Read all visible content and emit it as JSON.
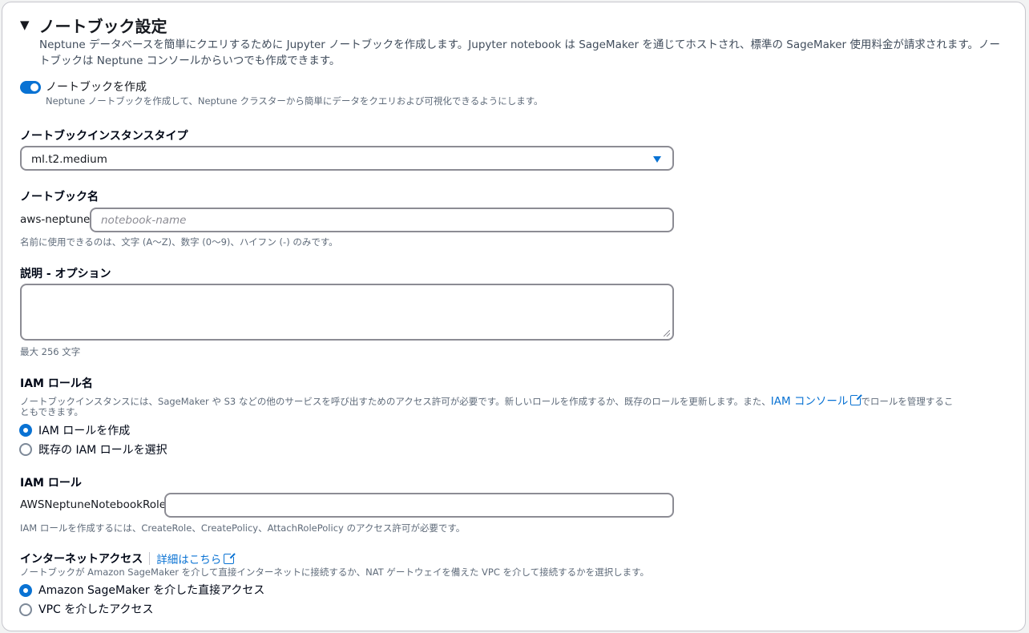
{
  "section": {
    "title": "ノートブック設定",
    "description_line1": "Neptune データベースを簡単にクエリするために Jupyter ノートブックを作成します。Jupyter notebook は SageMaker を通じてホストされ、標準の SageMaker 使用料金が請求されます。ノー",
    "description_line2": "トブックは Neptune コンソールからいつでも作成できます。"
  },
  "create_notebook": {
    "label": "ノートブックを作成",
    "description": "Neptune ノートブックを作成して、Neptune クラスターから簡単にデータをクエリおよび可視化できるようにします。",
    "enabled": true
  },
  "instance_type": {
    "label": "ノートブックインスタンスタイプ",
    "value": "ml.t2.medium"
  },
  "notebook_name": {
    "label": "ノートブック名",
    "prefix": "aws-neptune-",
    "placeholder": "notebook-name",
    "value": "",
    "hint": "名前に使用できるのは、文字 (A〜Z)、数字 (0〜9)、ハイフン (-) のみです。"
  },
  "description_field": {
    "label": "説明 - オプション",
    "value": "",
    "hint": "最大 256 文字"
  },
  "iam_role_name": {
    "label": "IAM ロール名",
    "description_part1": "ノートブックインスタンスには、SageMaker や S3 などの他のサービスを呼び出すためのアクセス許可が必要です。新しいロールを作成するか、既存のロールを更新します。また、",
    "console_link": "IAM コンソール",
    "description_part2": "でロールを管理するこ",
    "description_line2": "ともできます。",
    "options": [
      {
        "label": "IAM ロールを作成",
        "selected": true
      },
      {
        "label": "既存の IAM ロールを選択",
        "selected": false
      }
    ]
  },
  "iam_role": {
    "label": "IAM ロール",
    "prefix": "AWSNeptuneNotebookRole-",
    "value": "",
    "hint": "IAM ロールを作成するには、CreateRole、CreatePolicy、AttachRolePolicy のアクセス許可が必要です。"
  },
  "internet_access": {
    "label": "インターネットアクセス",
    "info_link": "詳細はこちら",
    "description": "ノートブックが Amazon SageMaker を介して直接インターネットに接続するか、NAT ゲートウェイを備えた VPC を介して接続するかを選択します。",
    "options": [
      {
        "label": "Amazon SageMaker を介した直接アクセス",
        "selected": true
      },
      {
        "label": "VPC を介したアクセス",
        "selected": false
      }
    ]
  },
  "colors": {
    "accent": "#0972d3",
    "border": "#8c8c94",
    "text": "#16191f",
    "muted": "#5f6b7a"
  }
}
